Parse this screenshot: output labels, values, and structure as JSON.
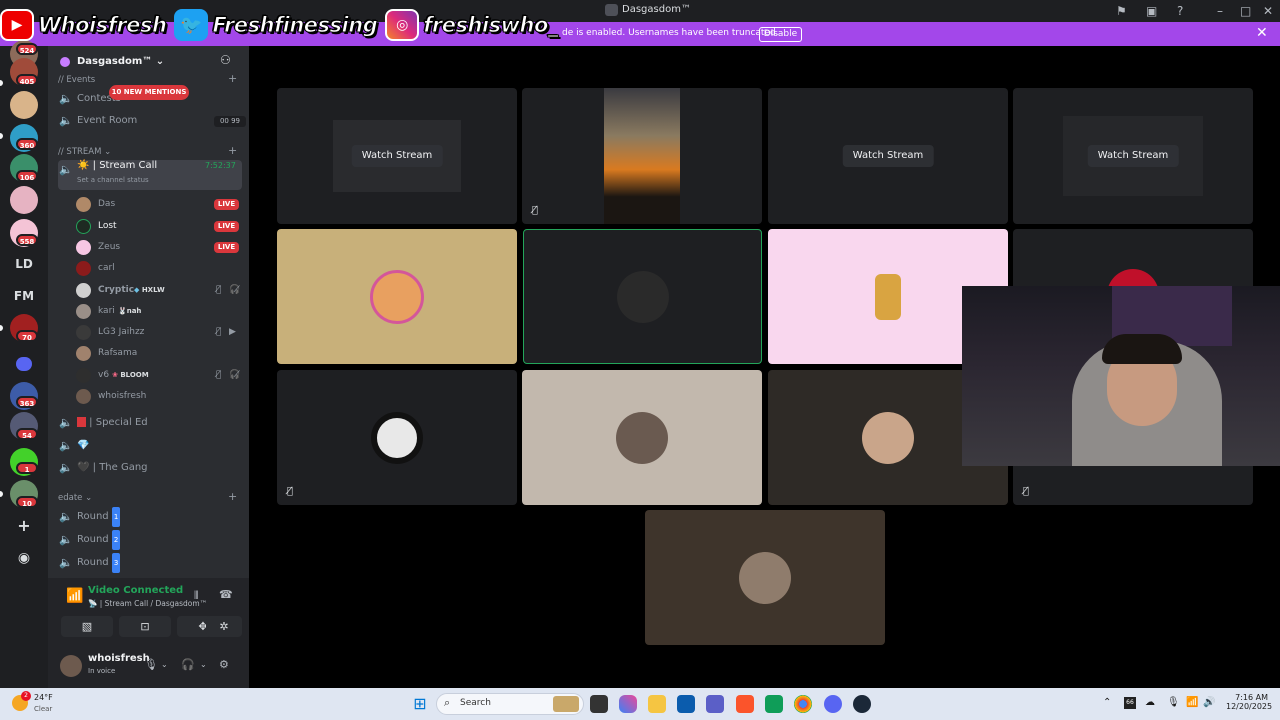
{
  "window": {
    "title": "Dasgasdom™"
  },
  "overlay": {
    "youtube": "Whoisfresh",
    "twitter": "Freshfinessing",
    "instagram": "freshiswho_"
  },
  "banner": {
    "message": "de is enabled. Usernames have been truncated.",
    "disable_label": "Disable"
  },
  "rail": {
    "servers": [
      {
        "badge": "524"
      },
      {
        "badge": "405"
      },
      {
        "badge": ""
      },
      {
        "badge": "360"
      },
      {
        "badge": "106"
      },
      {
        "badge": ""
      },
      {
        "badge": "558"
      },
      {
        "text": "LD"
      },
      {
        "text": "FM"
      },
      {
        "badge": "70"
      },
      {
        "badge": ""
      },
      {
        "badge": "363"
      },
      {
        "badge": "54"
      },
      {
        "badge": "1"
      },
      {
        "badge": "10"
      }
    ]
  },
  "sidebar": {
    "server_name": "Dasgasdom™",
    "mentions_pill": "10 NEW MENTIONS",
    "categories": {
      "events": "// Events",
      "stream": "// STREAM",
      "edate": "edate"
    },
    "channels": {
      "contests": "Contests",
      "event_room": "Event Room",
      "event_room_count": "00 99",
      "stream_call": "Stream Call",
      "stream_call_emoji": "☀️",
      "stream_call_time": "7:52:37",
      "stream_call_status": "Set a channel status",
      "special_ed": "Special Ed",
      "gem": "💎",
      "the_gang": "The Gang",
      "round1": "Round",
      "round2": "Round",
      "round3": "Round",
      "round1_num": "1",
      "round2_num": "2",
      "round3_num": "3"
    },
    "members": [
      {
        "name": "Das",
        "live": "LIVE"
      },
      {
        "name": "Lost",
        "live": "LIVE"
      },
      {
        "name": "Zeus",
        "live": "LIVE"
      },
      {
        "name": "carl",
        "live": ""
      },
      {
        "name": "Cryptic",
        "tag": "HXLW",
        "live": ""
      },
      {
        "name": "kari",
        "tag": "nah",
        "live": ""
      },
      {
        "name": "LG3 Jaihzz",
        "live": ""
      },
      {
        "name": "Rafsama",
        "live": ""
      },
      {
        "name": "v6",
        "tag": "BLOOM",
        "live": ""
      },
      {
        "name": "whoisfresh",
        "live": ""
      }
    ]
  },
  "voice": {
    "status": "Video Connected",
    "location": "Stream Call / Dasgasdom™"
  },
  "user": {
    "name": "whoisfresh",
    "status": "In voice"
  },
  "tiles": {
    "watch_label": "Watch Stream"
  },
  "taskbar": {
    "temp": "24°F",
    "condition": "Clear",
    "weather_badge": "2",
    "search_placeholder": "Search",
    "time": "7:16 AM",
    "date": "12/20/2025"
  },
  "colors": {
    "banner": "#a347ea",
    "live": "#da373c",
    "connected": "#23a55a",
    "speaking_border": "#23a55a"
  }
}
